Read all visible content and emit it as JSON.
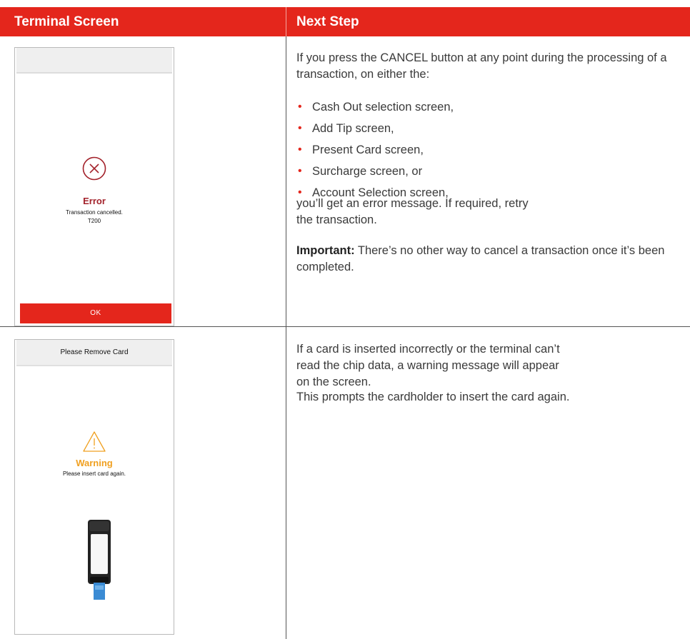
{
  "header": {
    "col1": "Terminal Screen",
    "col2": "Next Step"
  },
  "row1": {
    "screen": {
      "title": "Error",
      "message_line1": "Transaction cancelled.",
      "message_line2": "T200",
      "button": "OK",
      "icon": "close-circle-icon",
      "title_color": "#a3222b"
    },
    "intro": "If you press the CANCEL button at any point during the processing of a transaction, on either the:",
    "bullets": [
      "Cash Out selection screen,",
      "Add Tip screen,",
      "Present Card screen,",
      "Surcharge screen, or",
      "Account Selection screen,"
    ],
    "after": "you’ll get an error message. If required, retry the transaction.",
    "important_label": "Important:",
    "important_text": " There’s no other way to cancel a transaction once it’s been completed."
  },
  "row2": {
    "screen": {
      "topbar": "Please Remove Card",
      "title": "Warning",
      "message": "Please insert card again.",
      "icon": "warning-triangle-icon",
      "title_color": "#f0a020"
    },
    "para1": "If a card is inserted incorrectly or the terminal can’t read the chip data, a warning message will appear on the screen.",
    "para2": "This prompts the cardholder to insert the card again."
  },
  "colors": {
    "brand_red": "#e4261c",
    "bullet_color": "#e4261c"
  }
}
